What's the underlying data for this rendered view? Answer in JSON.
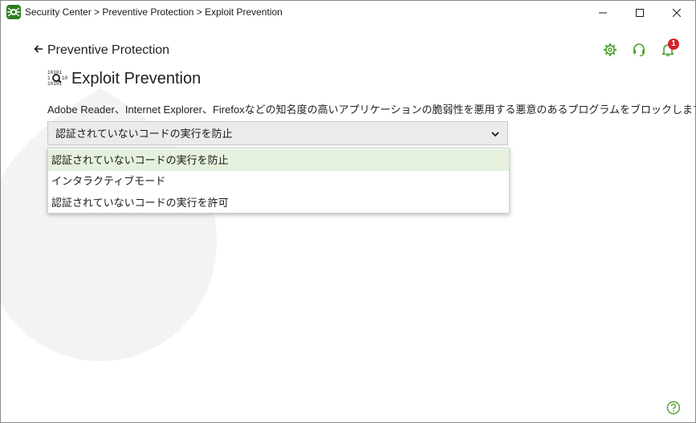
{
  "window": {
    "title": "Security Center > Preventive Protection > Exploit Prevention",
    "app_icon": "dr-web-spider-icon",
    "controls": [
      "minimize-icon",
      "maximize-icon",
      "close-icon"
    ]
  },
  "header": {
    "back_arrow": "🡐",
    "back_label": "Preventive Protection",
    "icons": [
      "gear-icon",
      "headset-icon",
      "bell-icon"
    ],
    "notification_count": "1"
  },
  "page": {
    "icon": "binary-magnifier-icon",
    "title": "Exploit Prevention",
    "description": "Adobe Reader、Internet Explorer、Firefoxなどの知名度の高いアプリケーションの脆弱性を悪用する悪意のあるプログラムをブロックします。"
  },
  "select": {
    "value": "認証されていないコードの実行を防止",
    "options": [
      {
        "label": "認証されていないコードの実行を防止",
        "selected": true
      },
      {
        "label": "インタラクティブモード",
        "selected": false
      },
      {
        "label": "認証されていないコードの実行を許可",
        "selected": false
      }
    ]
  },
  "footer": {
    "help_icon": "help-icon"
  },
  "colors": {
    "accent_green": "#4ca12b",
    "badge_red": "#d4202a",
    "selected_row": "#e5f1dd"
  }
}
